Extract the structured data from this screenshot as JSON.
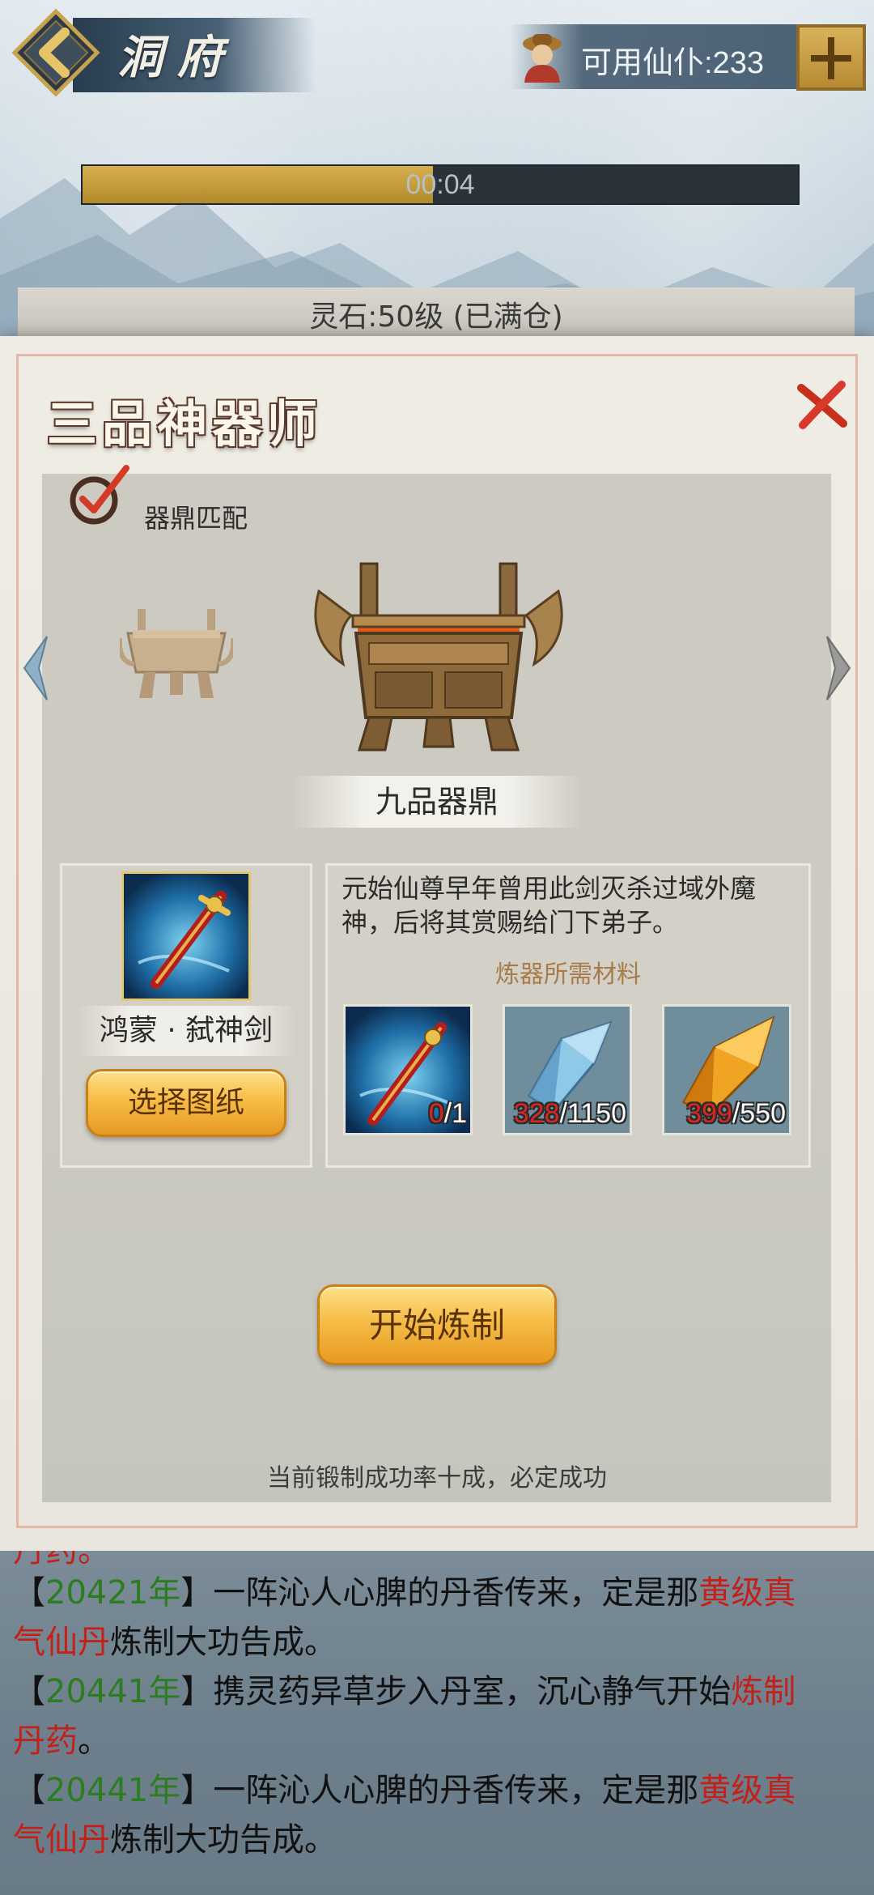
{
  "header": {
    "title": "洞府",
    "servant_label": "可用仙仆:233"
  },
  "progress": {
    "text": "00:04",
    "fraction": 0.49
  },
  "resource": {
    "stone_label": "灵石:50级 (已满仓)"
  },
  "dialog": {
    "title": "三品神器师",
    "match_label": "器鼎匹配",
    "cauldron_name": "九品器鼎",
    "blueprint": {
      "name": "鸿蒙 · 弑神剑",
      "select_button": "选择图纸"
    },
    "description": "元始仙尊早年曾用此剑灭杀过域外魔神，后将其赏赐给门下弟子。",
    "materials_header": "炼器所需材料",
    "materials": [
      {
        "icon": "sword-blueprint-icon",
        "have": "0",
        "need": "/1"
      },
      {
        "icon": "blue-crystal-icon",
        "have": "328",
        "need": "/1150"
      },
      {
        "icon": "amber-crystal-icon",
        "have": "399",
        "need": "/550"
      }
    ],
    "start_button": "开始炼制",
    "success_rate": "当前锻制成功率十成，必定成功"
  },
  "log": {
    "lines": [
      {
        "parts": [
          {
            "t": "丹药。",
            "c": "red"
          }
        ]
      },
      {
        "parts": [
          {
            "t": "【",
            "c": ""
          },
          {
            "t": "20421年",
            "c": "green"
          },
          {
            "t": "】一阵沁人心脾的丹香传来，定是那",
            "c": ""
          },
          {
            "t": "黄级真",
            "c": "red"
          }
        ]
      },
      {
        "parts": [
          {
            "t": "气仙丹",
            "c": "red"
          },
          {
            "t": "炼制大功告成。",
            "c": ""
          }
        ]
      },
      {
        "parts": [
          {
            "t": "【",
            "c": ""
          },
          {
            "t": "20441年",
            "c": "green"
          },
          {
            "t": "】携灵药异草步入丹室，沉心静气开始",
            "c": ""
          },
          {
            "t": "炼制",
            "c": "red"
          }
        ]
      },
      {
        "parts": [
          {
            "t": "丹药",
            "c": "red"
          },
          {
            "t": "。",
            "c": ""
          }
        ]
      },
      {
        "parts": [
          {
            "t": "【",
            "c": ""
          },
          {
            "t": "20441年",
            "c": "green"
          },
          {
            "t": "】一阵沁人心脾的丹香传来，定是那",
            "c": ""
          },
          {
            "t": "黄级真",
            "c": "red"
          }
        ]
      },
      {
        "parts": [
          {
            "t": "气仙丹",
            "c": "red"
          },
          {
            "t": "炼制大功告成。",
            "c": ""
          }
        ]
      }
    ]
  },
  "colors": {
    "accent_gold": "#f6bd47",
    "log_highlight_red": "#c3201a",
    "log_highlight_green": "#2b7d1f",
    "count_have_red": "#d9261f"
  }
}
